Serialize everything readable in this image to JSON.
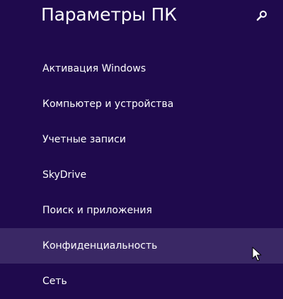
{
  "header": {
    "title": "Параметры ПК",
    "search_icon": "search-icon"
  },
  "nav": {
    "items": [
      {
        "label": "Активация Windows"
      },
      {
        "label": "Компьютер и устройства"
      },
      {
        "label": "Учетные записи"
      },
      {
        "label": "SkyDrive"
      },
      {
        "label": "Поиск и приложения"
      },
      {
        "label": "Конфиденциальность",
        "state": "hover"
      },
      {
        "label": "Сеть"
      }
    ]
  },
  "colors": {
    "background": "#1f0a4d",
    "hover_background": "#3a2865",
    "text": "#ffffff"
  }
}
